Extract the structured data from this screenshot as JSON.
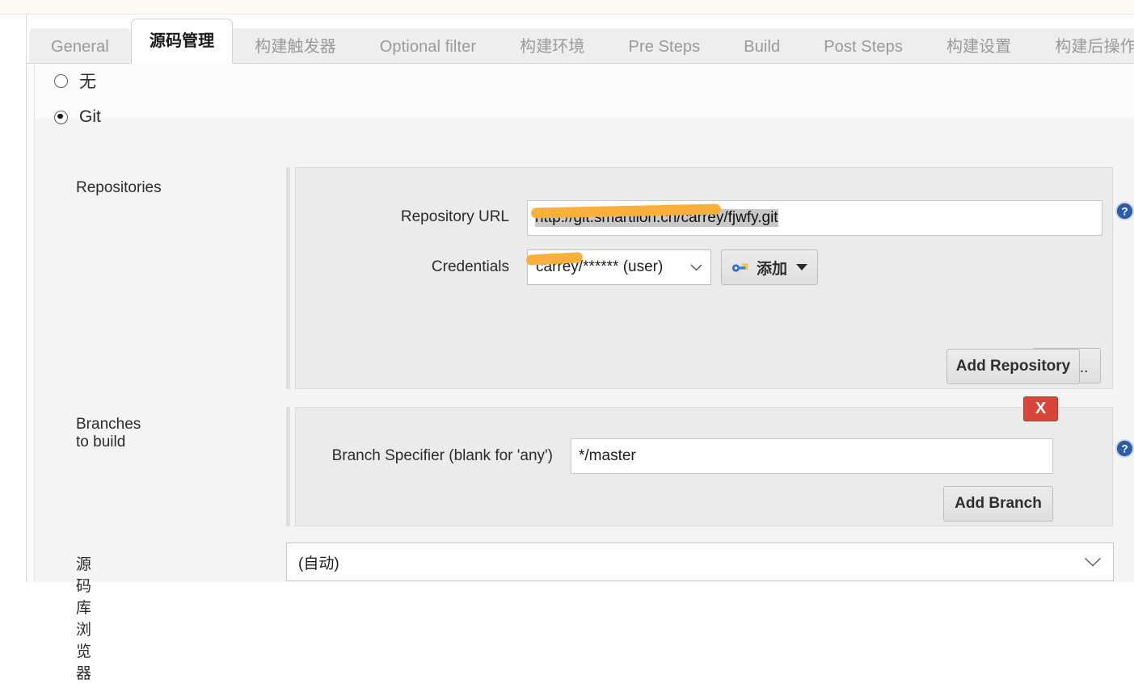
{
  "tabs": [
    {
      "label": "General",
      "active": false
    },
    {
      "label": "源码管理",
      "active": true
    },
    {
      "label": "构建触发器",
      "active": false
    },
    {
      "label": "Optional filter",
      "active": false
    },
    {
      "label": "构建环境",
      "active": false
    },
    {
      "label": "Pre Steps",
      "active": false
    },
    {
      "label": "Build",
      "active": false
    },
    {
      "label": "Post Steps",
      "active": false
    },
    {
      "label": "构建设置",
      "active": false
    },
    {
      "label": "构建后操作",
      "active": false
    }
  ],
  "scm": {
    "options": [
      {
        "label": "无",
        "selected": false
      },
      {
        "label": "Git",
        "selected": true
      }
    ]
  },
  "repositories": {
    "section_label": "Repositories",
    "url_label": "Repository URL",
    "url_value": "http://git.smartlion.cn/carrey/fjwfy.git",
    "url_redacted": true,
    "credentials_label": "Credentials",
    "credentials_value": "carrey/****** (user)",
    "credentials_redacted": true,
    "add_credentials_label": "添加",
    "advanced_label": "高级...",
    "add_repository_label": "Add Repository"
  },
  "branches": {
    "section_label": "Branches to build",
    "specifier_label": "Branch Specifier (blank for 'any')",
    "specifier_value": "*/master",
    "delete_label": "X",
    "add_branch_label": "Add Branch"
  },
  "browser": {
    "label": "源码库浏览器",
    "value": "(自动)"
  },
  "colors": {
    "accent_help": "#2d5ca8",
    "danger": "#d9453b",
    "redaction": "#fbb03b",
    "panel_bg": "#ebebeb",
    "page_bg": "#f4f4f4"
  }
}
